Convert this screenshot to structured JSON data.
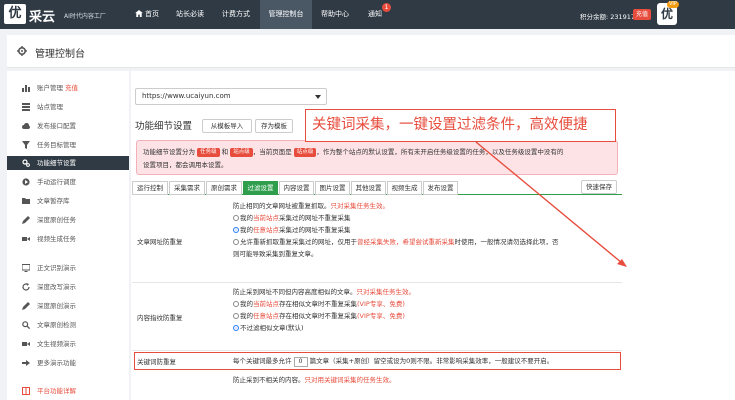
{
  "topbar": {
    "logo_char": "优",
    "logo_text": "采云",
    "slogan": "AI时代内容工厂",
    "nav": [
      {
        "label": "首页",
        "icon": "home-icon"
      },
      {
        "label": "站长必读"
      },
      {
        "label": "计费方式"
      },
      {
        "label": "管理控制台",
        "active": true
      },
      {
        "label": "帮助中心"
      },
      {
        "label": "通知",
        "badge": "1"
      }
    ],
    "points": "积分余额: 2319178",
    "recharge": "充值",
    "avatar_char": "优",
    "vip": "VIP"
  },
  "page": {
    "title": "管理控制台"
  },
  "sidebar": {
    "items": [
      {
        "label": "账户管理",
        "extra": "充值",
        "icon": "bar-chart-icon"
      },
      {
        "label": "站点管理",
        "icon": "list-icon"
      },
      {
        "label": "发布接口配置",
        "icon": "cloud-icon"
      },
      {
        "label": "任务目标管理",
        "icon": "filter-icon"
      },
      {
        "label": "功能细节设置",
        "icon": "gears-icon",
        "active": true
      },
      {
        "label": "手动运行调度",
        "icon": "play-icon"
      },
      {
        "label": "文章暂存库",
        "icon": "folder-icon"
      },
      {
        "label": "深度原创任务",
        "icon": "pencil-icon"
      },
      {
        "label": "视频生成任务",
        "icon": "video-icon"
      },
      {
        "label": "正文识别演示",
        "icon": "monitor-icon"
      },
      {
        "label": "深度改写演示",
        "icon": "refresh-icon"
      },
      {
        "label": "深度原创演示",
        "icon": "pencil-icon"
      },
      {
        "label": "文章原创检测",
        "icon": "search-icon"
      },
      {
        "label": "文生视频演示",
        "icon": "video-icon"
      },
      {
        "label": "更多演示功能",
        "icon": "arrow-icon"
      },
      {
        "label": "平台功能详解",
        "icon": "book-icon",
        "red": true
      }
    ]
  },
  "main": {
    "site_select": "https://www.ucaiyun.com",
    "section_title": "功能细节设置",
    "import_btn": "从模板导入",
    "save_template_btn": "存为模板",
    "alert": {
      "line1_a": "功能细节设置分为",
      "pill1": "任务级",
      "line1_b": "和",
      "pill2": "站点级",
      "line1_c": "，当前页面是",
      "pill3": "站点级",
      "line1_d": "，作为整个站点的默认设置，所有未开启任务级设置的任务，以及任务级设置中没有的",
      "line2": "设置项目，都会调用本设置。"
    },
    "tabs": [
      "运行控制",
      "采集需求",
      "原创需求",
      "过滤设置",
      "内容设置",
      "图片设置",
      "其他设置",
      "视频生成",
      "发布设置"
    ],
    "active_tab": "过滤设置",
    "quick_save": "快速保存",
    "section1": {
      "label": "文章网址防重复",
      "desc_a": "防止相同的文章网址被重复抓取。",
      "desc_b": "只对采集任务生效。",
      "opt1_a": "我的",
      "opt1_b": "当前站点",
      "opt1_c": "采集过的网址不重复采集",
      "opt2_a": "我的",
      "opt2_b": "任意站点",
      "opt2_c": "采集过的网址不重复采集",
      "opt3_a": "允许重新抓取重复采集过的网址，仅用于",
      "opt3_b": "曾经采集失败，希望尝试重新采集",
      "opt3_c": "时使用，一般情况请勿选择此项，否",
      "opt3_d": "则可能导致采集到重复文章。"
    },
    "section2": {
      "label": "内容指纹防重复",
      "desc_a": "防止采到网址不同但内容高度相似的文章。",
      "desc_b": "只对采集任务生效。",
      "opt1_a": "我的",
      "opt1_b": "当前站点",
      "opt1_c": "存在相似文章时不重复采集",
      "opt1_d": "(VIP专享、免费)",
      "opt2_a": "我的",
      "opt2_b": "任意站点",
      "opt2_c": "存在相似文章时不重复采集",
      "opt2_d": "(VIP专享、免费)",
      "opt3": "不过滤相似文章(默认)"
    },
    "section3": {
      "label": "关键词防重复",
      "text_a": "每个关键词最多允许",
      "value": "0",
      "text_b": "篇文章（采集+原创）留空或设为0则不限。非常影响采集效率，一般建议不要开启。"
    },
    "section4": {
      "desc_a": "防止采到不相关的内容。",
      "desc_b": "只对用关键词采集的任务生效。"
    },
    "callout": "关键词采集，一键设置过滤条件，高效便捷"
  },
  "colors": {
    "topbar": "#2f3a45",
    "accent_green": "#2e9e4d",
    "alert_red": "#e74c3c"
  }
}
